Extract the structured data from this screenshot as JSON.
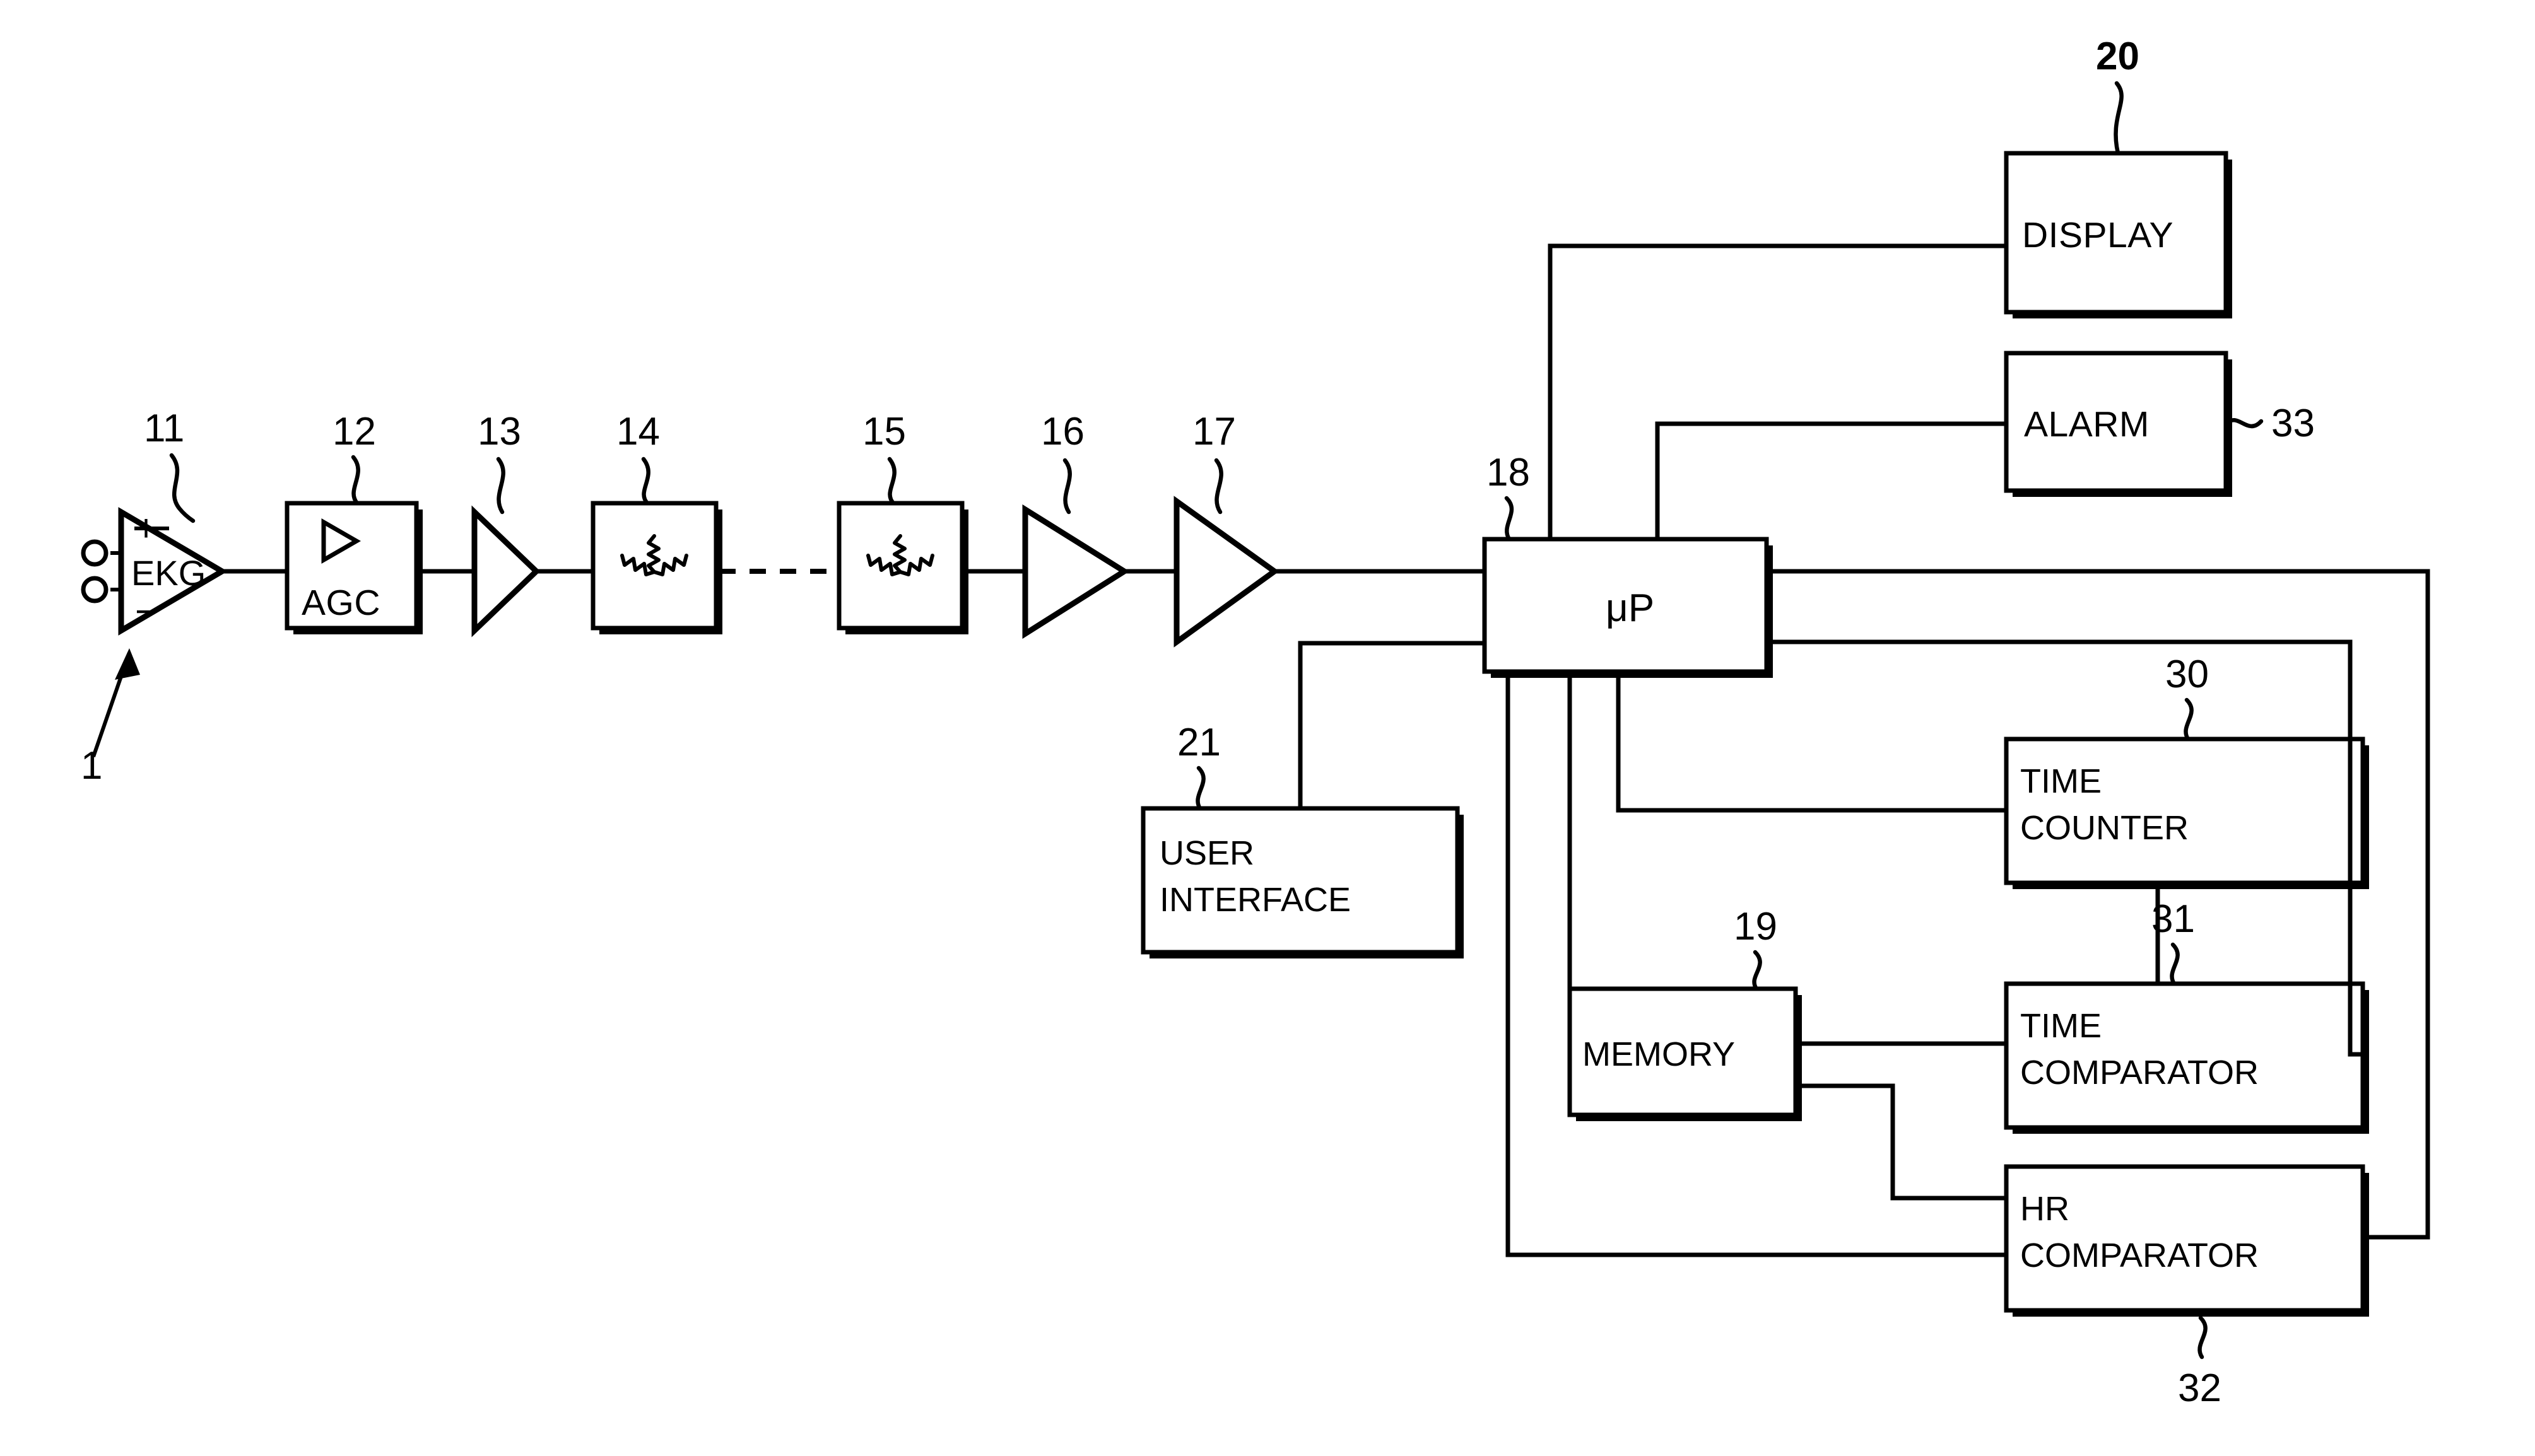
{
  "figure": {
    "kind": "patent-block-diagram",
    "subject": "EKG heart-rate monitoring signal chain",
    "line_color": "#000000",
    "background_color": "#ffffff"
  },
  "blocks": {
    "ekg_amp": {
      "label": "EKG",
      "ref": "11",
      "plus": "+",
      "minus": "−",
      "shape": "triangle-amplifier"
    },
    "agc": {
      "label": "AGC",
      "ref": "12",
      "icon": "amplifier-triangle-icon",
      "shape": "rect"
    },
    "amp13": {
      "label": "",
      "ref": "13",
      "shape": "triangle-amplifier"
    },
    "filter14": {
      "label": "",
      "ref": "14",
      "icon": "filter-star-icon",
      "shape": "rect"
    },
    "filter15": {
      "label": "",
      "ref": "15",
      "icon": "filter-star-icon",
      "shape": "rect"
    },
    "amp16": {
      "label": "",
      "ref": "16",
      "shape": "triangle-amplifier"
    },
    "amp17": {
      "label": "",
      "ref": "17",
      "shape": "triangle-amplifier"
    },
    "microprocessor": {
      "label": "μP",
      "ref": "18",
      "shape": "rect"
    },
    "display": {
      "label": "DISPLAY",
      "ref": "20",
      "shape": "rect"
    },
    "alarm": {
      "label": "ALARM",
      "ref": "33",
      "shape": "rect"
    },
    "user_interface": {
      "label_line1": "USER",
      "label_line2": "INTERFACE",
      "ref": "21",
      "shape": "rect"
    },
    "memory": {
      "label": "MEMORY",
      "ref": "19",
      "shape": "rect"
    },
    "time_counter": {
      "label_line1": "TIME",
      "label_line2": "COUNTER",
      "ref": "30",
      "shape": "rect"
    },
    "time_comparator": {
      "label_line1": "TIME",
      "label_line2": "COMPARATOR",
      "ref": "31",
      "shape": "rect"
    },
    "hr_comparator": {
      "label_line1": "HR",
      "label_line2": "COMPARATOR",
      "ref": "32",
      "shape": "rect"
    }
  },
  "system_ref": {
    "label": "1",
    "description": "overall-system-arrow"
  },
  "reference_numerals": [
    "1",
    "11",
    "12",
    "13",
    "14",
    "15",
    "16",
    "17",
    "18",
    "19",
    "20",
    "21",
    "30",
    "31",
    "32",
    "33"
  ]
}
